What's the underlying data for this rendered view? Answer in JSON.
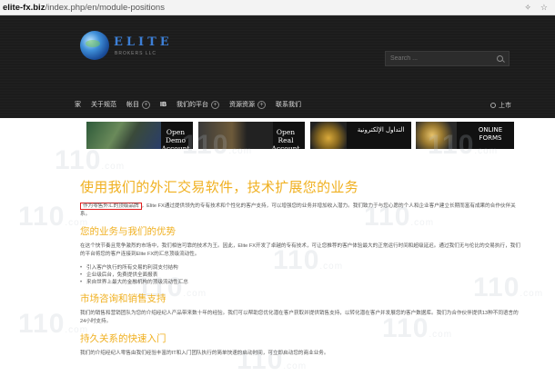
{
  "browser": {
    "url_host": "elite-fx.biz",
    "url_path": "/index.php/en/module-positions"
  },
  "header": {
    "logo_text": "ELITE",
    "logo_sub": "BROKERS LLC",
    "search_placeholder": "Search ...",
    "nav": [
      {
        "label": "家",
        "has_plus": false
      },
      {
        "label": "关于规范",
        "has_plus": false
      },
      {
        "label": "帐目",
        "has_plus": true
      },
      {
        "label": "IB",
        "has_plus": false
      },
      {
        "label": "我们的平台",
        "has_plus": true
      },
      {
        "label": "资源资源",
        "has_plus": true
      },
      {
        "label": "联系我们",
        "has_plus": false
      }
    ],
    "nav_right": "上市"
  },
  "banners": [
    {
      "text": "Open Demo Account"
    },
    {
      "text": "Open Real Account"
    },
    {
      "text": "التداول الإلكترونية"
    },
    {
      "text": "ONLINE FORMS"
    }
  ],
  "content": {
    "h1": "使用我们的外汇交易软件，技术扩展您的业务",
    "p1_highlight": "作为零售外汇的顶级品牌",
    "p1_rest": "，Elite FX通过提供领先的专有技术和个性化的客户支持，可以增强您的业务并增加收入潜力。我们致力于与您心愿的个人和企业客户建立长期而富有成果的合作伙伴关系。",
    "h2_1": "您的业务与我们的优势",
    "p2": "在这个快节奏且竞争激烈的市场中，我们相信可靠的技术为王。因此，Elite FX开发了卓越的专有技术，可让您推荐的客户体验最大的正常运行时间和超级延迟。通过我们无与伦比的交易执行，我们的平台将您的客户连接到Elite FX的汇总顶级流动性。",
    "list": [
      "引入客户执行的所有交易的利润支付结构",
      "企业级后台，免费提供全面报表",
      "来自世界上最大的金融机构的顶级流动性汇总"
    ],
    "h2_2": "市场咨询和销售支持",
    "p3": "我们的销售和营销团队为您的介绍经纪人产品带来数十年的经验。我们可以帮助您优化潜在客户获取并提供销售支持，以转化潜在客户并发展您的客户数据库。我们为合作伙伴提供13种不同语言的24小时支持。",
    "h2_3": "持久关系的快速入门",
    "p4": "我们的介绍经纪人零售由我们经验丰富的IT和入门团队执行的简单快速的启动时间，可立即启动您的商业业务。"
  },
  "watermark": "110",
  "watermark_suffix": ".com"
}
